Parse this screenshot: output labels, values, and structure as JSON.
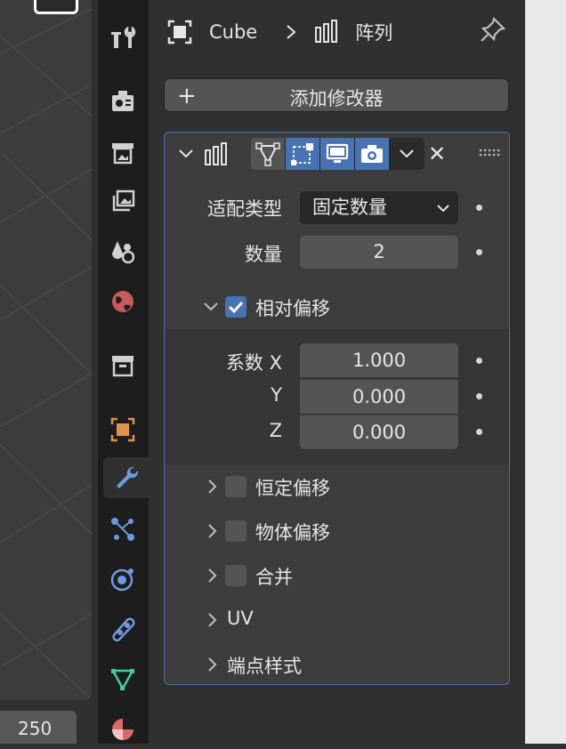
{
  "viewport": {
    "frame_value": "250"
  },
  "tabs": [
    {
      "name": "tool-tab",
      "icon": "tool-icon"
    },
    {
      "name": "render-tab",
      "icon": "render-icon"
    },
    {
      "name": "output-tab",
      "icon": "output-icon"
    },
    {
      "name": "view-layer-tab",
      "icon": "view-layer-icon"
    },
    {
      "name": "scene-tab",
      "icon": "scene-icon"
    },
    {
      "name": "world-tab",
      "icon": "world-icon"
    },
    {
      "name": "collection-tab",
      "icon": "collection-icon"
    },
    {
      "name": "object-tab",
      "icon": "object-icon"
    },
    {
      "name": "modifier-tab",
      "icon": "wrench-icon",
      "active": true
    },
    {
      "name": "particles-tab",
      "icon": "particles-icon"
    },
    {
      "name": "physics-tab",
      "icon": "physics-icon"
    },
    {
      "name": "constraints-tab",
      "icon": "constraints-icon"
    },
    {
      "name": "data-tab",
      "icon": "mesh-data-icon"
    },
    {
      "name": "material-tab",
      "icon": "material-icon"
    }
  ],
  "header": {
    "object": "Cube",
    "modifier": "阵列"
  },
  "add_modifier": {
    "label": "添加修改器"
  },
  "modifier": {
    "fit_type": {
      "label": "适配类型",
      "value": "固定数量"
    },
    "count": {
      "label": "数量",
      "value": "2"
    },
    "relative_offset": {
      "label": "相对偏移",
      "checked": true,
      "factor_label": "系数 X",
      "y_label": "Y",
      "z_label": "Z",
      "x": "1.000",
      "y": "0.000",
      "z": "0.000"
    },
    "constant_offset": {
      "label": "恒定偏移",
      "checked": false
    },
    "object_offset": {
      "label": "物体偏移",
      "checked": false
    },
    "merge": {
      "label": "合并",
      "checked": false
    },
    "uv": {
      "label": "UV"
    },
    "caps": {
      "label": "端点样式"
    }
  },
  "colors": {
    "accent": "#4772b3",
    "panel": "#303030",
    "field": "#545454"
  }
}
